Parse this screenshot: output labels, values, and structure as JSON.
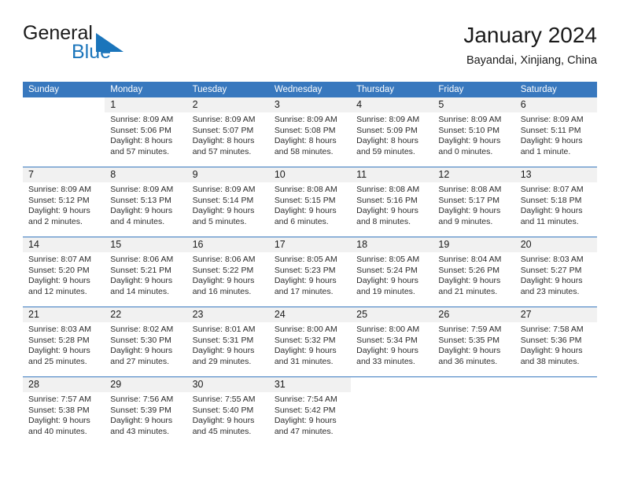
{
  "brand": {
    "name_part1": "General",
    "name_part2": "Blue",
    "logo_icon": "triangle-logo-icon",
    "accent_color": "#1b75bb"
  },
  "header": {
    "title": "January 2024",
    "location": "Bayandai, Xinjiang, China"
  },
  "calendar": {
    "header_color": "#3878be",
    "weekday_headers": [
      "Sunday",
      "Monday",
      "Tuesday",
      "Wednesday",
      "Thursday",
      "Friday",
      "Saturday"
    ],
    "weeks": [
      [
        {
          "day": "",
          "sunrise": "",
          "sunset": "",
          "daylight_line1": "",
          "daylight_line2": ""
        },
        {
          "day": "1",
          "sunrise": "Sunrise: 8:09 AM",
          "sunset": "Sunset: 5:06 PM",
          "daylight_line1": "Daylight: 8 hours",
          "daylight_line2": "and 57 minutes."
        },
        {
          "day": "2",
          "sunrise": "Sunrise: 8:09 AM",
          "sunset": "Sunset: 5:07 PM",
          "daylight_line1": "Daylight: 8 hours",
          "daylight_line2": "and 57 minutes."
        },
        {
          "day": "3",
          "sunrise": "Sunrise: 8:09 AM",
          "sunset": "Sunset: 5:08 PM",
          "daylight_line1": "Daylight: 8 hours",
          "daylight_line2": "and 58 minutes."
        },
        {
          "day": "4",
          "sunrise": "Sunrise: 8:09 AM",
          "sunset": "Sunset: 5:09 PM",
          "daylight_line1": "Daylight: 8 hours",
          "daylight_line2": "and 59 minutes."
        },
        {
          "day": "5",
          "sunrise": "Sunrise: 8:09 AM",
          "sunset": "Sunset: 5:10 PM",
          "daylight_line1": "Daylight: 9 hours",
          "daylight_line2": "and 0 minutes."
        },
        {
          "day": "6",
          "sunrise": "Sunrise: 8:09 AM",
          "sunset": "Sunset: 5:11 PM",
          "daylight_line1": "Daylight: 9 hours",
          "daylight_line2": "and 1 minute."
        }
      ],
      [
        {
          "day": "7",
          "sunrise": "Sunrise: 8:09 AM",
          "sunset": "Sunset: 5:12 PM",
          "daylight_line1": "Daylight: 9 hours",
          "daylight_line2": "and 2 minutes."
        },
        {
          "day": "8",
          "sunrise": "Sunrise: 8:09 AM",
          "sunset": "Sunset: 5:13 PM",
          "daylight_line1": "Daylight: 9 hours",
          "daylight_line2": "and 4 minutes."
        },
        {
          "day": "9",
          "sunrise": "Sunrise: 8:09 AM",
          "sunset": "Sunset: 5:14 PM",
          "daylight_line1": "Daylight: 9 hours",
          "daylight_line2": "and 5 minutes."
        },
        {
          "day": "10",
          "sunrise": "Sunrise: 8:08 AM",
          "sunset": "Sunset: 5:15 PM",
          "daylight_line1": "Daylight: 9 hours",
          "daylight_line2": "and 6 minutes."
        },
        {
          "day": "11",
          "sunrise": "Sunrise: 8:08 AM",
          "sunset": "Sunset: 5:16 PM",
          "daylight_line1": "Daylight: 9 hours",
          "daylight_line2": "and 8 minutes."
        },
        {
          "day": "12",
          "sunrise": "Sunrise: 8:08 AM",
          "sunset": "Sunset: 5:17 PM",
          "daylight_line1": "Daylight: 9 hours",
          "daylight_line2": "and 9 minutes."
        },
        {
          "day": "13",
          "sunrise": "Sunrise: 8:07 AM",
          "sunset": "Sunset: 5:18 PM",
          "daylight_line1": "Daylight: 9 hours",
          "daylight_line2": "and 11 minutes."
        }
      ],
      [
        {
          "day": "14",
          "sunrise": "Sunrise: 8:07 AM",
          "sunset": "Sunset: 5:20 PM",
          "daylight_line1": "Daylight: 9 hours",
          "daylight_line2": "and 12 minutes."
        },
        {
          "day": "15",
          "sunrise": "Sunrise: 8:06 AM",
          "sunset": "Sunset: 5:21 PM",
          "daylight_line1": "Daylight: 9 hours",
          "daylight_line2": "and 14 minutes."
        },
        {
          "day": "16",
          "sunrise": "Sunrise: 8:06 AM",
          "sunset": "Sunset: 5:22 PM",
          "daylight_line1": "Daylight: 9 hours",
          "daylight_line2": "and 16 minutes."
        },
        {
          "day": "17",
          "sunrise": "Sunrise: 8:05 AM",
          "sunset": "Sunset: 5:23 PM",
          "daylight_line1": "Daylight: 9 hours",
          "daylight_line2": "and 17 minutes."
        },
        {
          "day": "18",
          "sunrise": "Sunrise: 8:05 AM",
          "sunset": "Sunset: 5:24 PM",
          "daylight_line1": "Daylight: 9 hours",
          "daylight_line2": "and 19 minutes."
        },
        {
          "day": "19",
          "sunrise": "Sunrise: 8:04 AM",
          "sunset": "Sunset: 5:26 PM",
          "daylight_line1": "Daylight: 9 hours",
          "daylight_line2": "and 21 minutes."
        },
        {
          "day": "20",
          "sunrise": "Sunrise: 8:03 AM",
          "sunset": "Sunset: 5:27 PM",
          "daylight_line1": "Daylight: 9 hours",
          "daylight_line2": "and 23 minutes."
        }
      ],
      [
        {
          "day": "21",
          "sunrise": "Sunrise: 8:03 AM",
          "sunset": "Sunset: 5:28 PM",
          "daylight_line1": "Daylight: 9 hours",
          "daylight_line2": "and 25 minutes."
        },
        {
          "day": "22",
          "sunrise": "Sunrise: 8:02 AM",
          "sunset": "Sunset: 5:30 PM",
          "daylight_line1": "Daylight: 9 hours",
          "daylight_line2": "and 27 minutes."
        },
        {
          "day": "23",
          "sunrise": "Sunrise: 8:01 AM",
          "sunset": "Sunset: 5:31 PM",
          "daylight_line1": "Daylight: 9 hours",
          "daylight_line2": "and 29 minutes."
        },
        {
          "day": "24",
          "sunrise": "Sunrise: 8:00 AM",
          "sunset": "Sunset: 5:32 PM",
          "daylight_line1": "Daylight: 9 hours",
          "daylight_line2": "and 31 minutes."
        },
        {
          "day": "25",
          "sunrise": "Sunrise: 8:00 AM",
          "sunset": "Sunset: 5:34 PM",
          "daylight_line1": "Daylight: 9 hours",
          "daylight_line2": "and 33 minutes."
        },
        {
          "day": "26",
          "sunrise": "Sunrise: 7:59 AM",
          "sunset": "Sunset: 5:35 PM",
          "daylight_line1": "Daylight: 9 hours",
          "daylight_line2": "and 36 minutes."
        },
        {
          "day": "27",
          "sunrise": "Sunrise: 7:58 AM",
          "sunset": "Sunset: 5:36 PM",
          "daylight_line1": "Daylight: 9 hours",
          "daylight_line2": "and 38 minutes."
        }
      ],
      [
        {
          "day": "28",
          "sunrise": "Sunrise: 7:57 AM",
          "sunset": "Sunset: 5:38 PM",
          "daylight_line1": "Daylight: 9 hours",
          "daylight_line2": "and 40 minutes."
        },
        {
          "day": "29",
          "sunrise": "Sunrise: 7:56 AM",
          "sunset": "Sunset: 5:39 PM",
          "daylight_line1": "Daylight: 9 hours",
          "daylight_line2": "and 43 minutes."
        },
        {
          "day": "30",
          "sunrise": "Sunrise: 7:55 AM",
          "sunset": "Sunset: 5:40 PM",
          "daylight_line1": "Daylight: 9 hours",
          "daylight_line2": "and 45 minutes."
        },
        {
          "day": "31",
          "sunrise": "Sunrise: 7:54 AM",
          "sunset": "Sunset: 5:42 PM",
          "daylight_line1": "Daylight: 9 hours",
          "daylight_line2": "and 47 minutes."
        },
        {
          "day": "",
          "sunrise": "",
          "sunset": "",
          "daylight_line1": "",
          "daylight_line2": ""
        },
        {
          "day": "",
          "sunrise": "",
          "sunset": "",
          "daylight_line1": "",
          "daylight_line2": ""
        },
        {
          "day": "",
          "sunrise": "",
          "sunset": "",
          "daylight_line1": "",
          "daylight_line2": ""
        }
      ]
    ]
  }
}
